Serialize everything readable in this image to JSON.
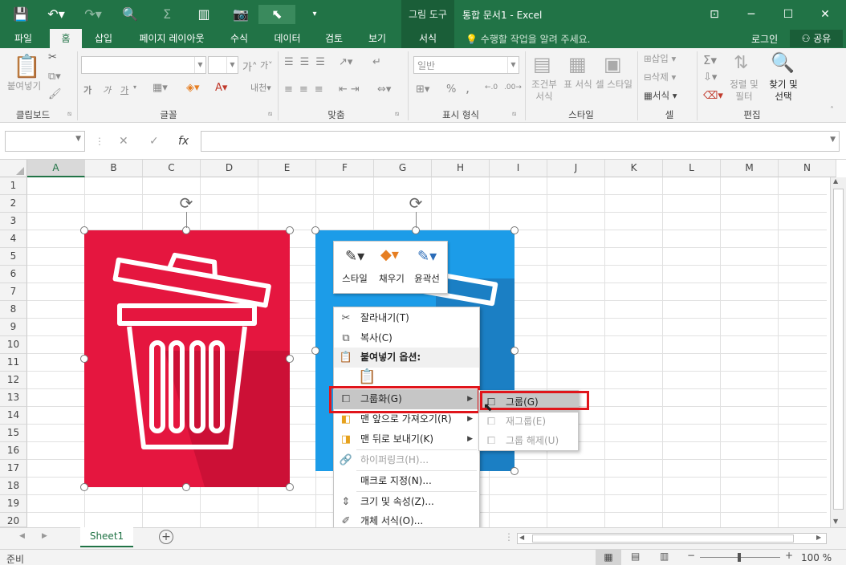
{
  "title_bar": {
    "picture_tools_label": "그림 도구",
    "window_title": "통합 문서1 - Excel",
    "qat": [
      "save-icon",
      "undo-icon",
      "redo-icon",
      "print-preview-icon",
      "sigma-icon",
      "column-icon",
      "camera-icon",
      "select-pointer-icon",
      "customize-qat-icon"
    ]
  },
  "tabs": [
    {
      "label": "파일",
      "state": "normal"
    },
    {
      "label": "홈",
      "state": "active"
    },
    {
      "label": "삽입",
      "state": "normal"
    },
    {
      "label": "페이지 레이아웃",
      "state": "normal"
    },
    {
      "label": "수식",
      "state": "normal"
    },
    {
      "label": "데이터",
      "state": "normal"
    },
    {
      "label": "검토",
      "state": "normal"
    },
    {
      "label": "보기",
      "state": "normal"
    },
    {
      "label": "서식",
      "state": "contextual"
    }
  ],
  "tell_me": "수행할 작업을 알려 주세요.",
  "login": "로그인",
  "share": "공유",
  "ribbon": {
    "clipboard": {
      "paste": "붙여넣기",
      "group": "클립보드"
    },
    "font": {
      "group": "글꼴",
      "bold": "가",
      "italic": "가",
      "underline": "가",
      "grow": "가",
      "shrink": "가",
      "phonetic": "내천"
    },
    "alignment": {
      "group": "맞춤"
    },
    "number": {
      "format": "일반",
      "group": "표시 형식",
      "percent": "%",
      "comma": ","
    },
    "styles": {
      "conditional": "조건부 서식",
      "table": "표 서식",
      "cell": "셀 스타일",
      "group": "스타일"
    },
    "cells": {
      "insert": "삽입",
      "delete": "삭제",
      "format": "서식",
      "group": "셀"
    },
    "editing": {
      "sort": "정렬 및 필터",
      "find": "찾기 및 선택",
      "group": "편집"
    }
  },
  "formula_bar": {
    "fx": "fx",
    "cancel": "✕",
    "enter": "✓"
  },
  "columns": [
    "A",
    "B",
    "C",
    "D",
    "E",
    "F",
    "G",
    "H",
    "I",
    "J",
    "K",
    "L",
    "M",
    "N"
  ],
  "rows": [
    "1",
    "2",
    "3",
    "4",
    "5",
    "6",
    "7",
    "8",
    "9",
    "10",
    "11",
    "12",
    "13",
    "14",
    "15",
    "16",
    "17",
    "18",
    "19",
    "20"
  ],
  "colors": {
    "excel_green": "#217346",
    "red_image": "#e5163f",
    "blue_image": "#1c9ce8",
    "highlight_box": "#e0151b"
  },
  "mini_toolbar": [
    {
      "label": "스타일",
      "icon": "style-icon"
    },
    {
      "label": "채우기",
      "icon": "fill-bucket-icon"
    },
    {
      "label": "윤곽선",
      "icon": "outline-pen-icon"
    }
  ],
  "context_menu": {
    "cut": "잘라내기(T)",
    "copy": "복사(C)",
    "paste_options": "붙여넣기 옵션:",
    "group": "그룹화(G)",
    "bring_front": "맨 앞으로 가져오기(R)",
    "send_back": "맨 뒤로 보내기(K)",
    "hyperlink": "하이퍼링크(H)...",
    "macro": "매크로 지정(N)...",
    "size": "크기 및 속성(Z)...",
    "format": "개체 서식(O)..."
  },
  "submenu": {
    "group": "그룹(G)",
    "regroup": "재그룹(E)",
    "ungroup": "그룹 해제(U)"
  },
  "sheet_tab": "Sheet1",
  "status": {
    "ready": "준비",
    "zoom": "100 %"
  }
}
